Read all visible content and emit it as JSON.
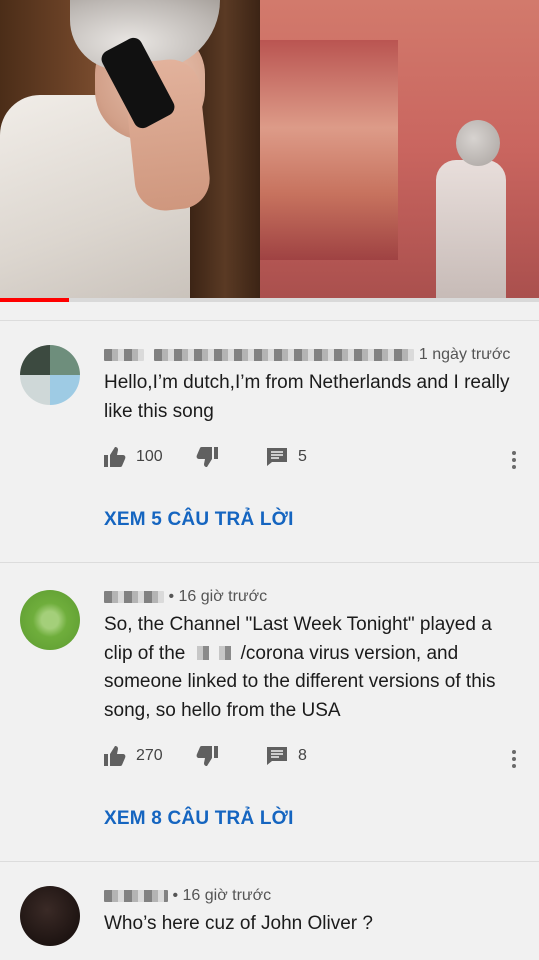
{
  "video": {
    "progress_fraction": 0.128
  },
  "comments": [
    {
      "time": "1 ngày trước",
      "text": "Hello,I’m dutch,I’m from Netherlands and I really like this song",
      "likes": "100",
      "reply_count": "5",
      "view_replies": "XEM 5 CÂU TRẢ LỜI",
      "avatar_colors": [
        "#6e8e7c",
        "#9ecbe4",
        "#3c4a40"
      ]
    },
    {
      "time": "16 giờ trước",
      "text_before": "So, the Channel \"Last Week Tonight\" played a clip of the",
      "text_after": "/corona virus version, and someone linked to the different versions of this song, so hello from the USA",
      "likes": "270",
      "reply_count": "8",
      "view_replies": "XEM 8 CÂU TRẢ LỜI",
      "avatar_colors": [
        "#6fae3c",
        "#a4cf7a"
      ]
    },
    {
      "time": "16 giờ trước",
      "text": "Who’s here cuz of John Oliver ?",
      "avatar_colors": [
        "#1e1412"
      ]
    }
  ],
  "icons": {
    "like": "thumb-up-icon",
    "dislike": "thumb-down-icon",
    "reply": "comment-icon",
    "more": "more-vert-icon"
  },
  "colors": {
    "link": "#1565c0",
    "progress": "#ff0000"
  }
}
